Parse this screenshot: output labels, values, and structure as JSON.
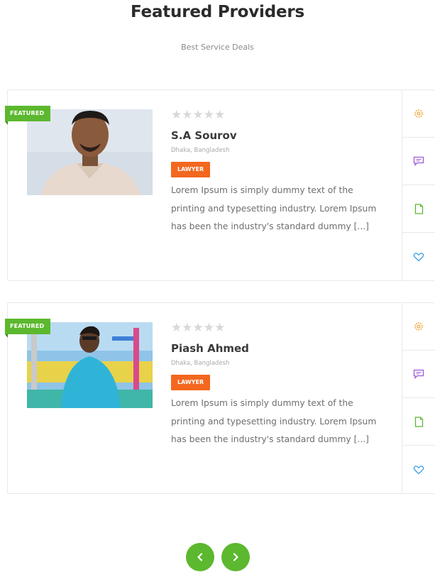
{
  "header": {
    "title": "Featured Providers",
    "subtitle": "Best Service Deals"
  },
  "colors": {
    "featured_badge": "#5cb82e",
    "category_badge": "#f3671f",
    "pager_button": "#5cb82e",
    "settings_icon": "#f2a93b",
    "message_icon": "#9b59d6",
    "document_icon": "#5cb82e",
    "heart_icon": "#3aa0e8"
  },
  "providers": [
    {
      "featured_label": "FEATURED",
      "stars": "★★★★★",
      "rating": 0,
      "name": "S.A Sourov",
      "location": "Dhaka, Bangladesh",
      "category": "LAWYER",
      "description": "Lorem Ipsum is simply dummy text of the printing and typesetting industry. Lorem Ipsum has been the industry's standard dummy [...]"
    },
    {
      "featured_label": "FEATURED",
      "stars": "★★★★★",
      "rating": 0,
      "name": "Piash Ahmed",
      "location": "Dhaka, Bangladesh",
      "category": "LAWYER",
      "description": "Lorem Ipsum is simply dummy text of the printing and typesetting industry. Lorem Ipsum has been the industry's standard dummy [...]"
    }
  ],
  "actions": [
    "settings-icon",
    "message-icon",
    "document-icon",
    "heart-icon"
  ],
  "pager": {
    "prev_icon": "chevron-left-icon",
    "next_icon": "chevron-right-icon"
  }
}
